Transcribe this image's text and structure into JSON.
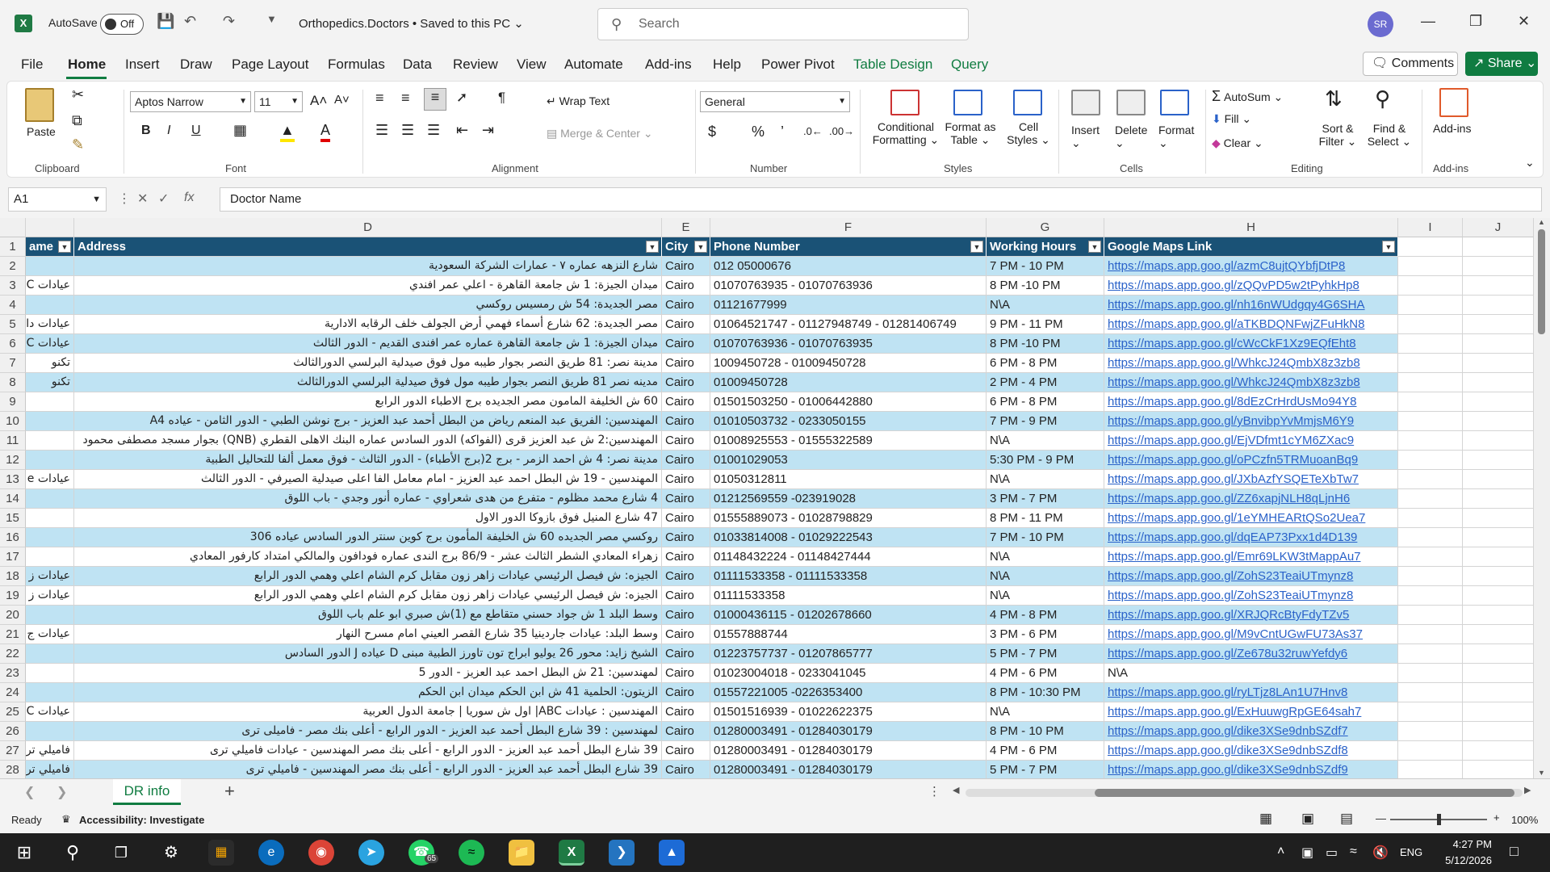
{
  "titlebar": {
    "autosave_label": "AutoSave",
    "autosave_state": "Off",
    "document_title": "Orthopedics.Doctors • Saved to this PC",
    "search_placeholder": "Search",
    "user_initials": "SR"
  },
  "menu": [
    "File",
    "Home",
    "Insert",
    "Draw",
    "Page Layout",
    "Formulas",
    "Data",
    "Review",
    "View",
    "Automate",
    "Add-ins",
    "Help",
    "Power Pivot",
    "Table Design",
    "Query"
  ],
  "menu_active": "Home",
  "actions": {
    "comments": "Comments",
    "share": "Share"
  },
  "ribbon": {
    "clipboard": {
      "label": "Clipboard",
      "paste": "Paste"
    },
    "font": {
      "label": "Font",
      "name": "Aptos Narrow",
      "size": "11"
    },
    "alignment": {
      "label": "Alignment",
      "wrap": "Wrap Text",
      "merge": "Merge & Center"
    },
    "number": {
      "label": "Number",
      "format": "General"
    },
    "styles": {
      "label": "Styles",
      "conditional": "Conditional",
      "conditional2": "Formatting",
      "format_as": "Format as",
      "format_as2": "Table",
      "cell": "Cell",
      "cell2": "Styles"
    },
    "cells": {
      "label": "Cells",
      "insert": "Insert",
      "delete": "Delete",
      "format": "Format"
    },
    "editing": {
      "label": "Editing",
      "autosum": "AutoSum",
      "fill": "Fill",
      "clear": "Clear",
      "sort": "Sort &",
      "sort2": "Filter",
      "find": "Find &",
      "find2": "Select"
    },
    "addins": {
      "label": "Add-ins",
      "btn": "Add-ins"
    }
  },
  "formula_bar": {
    "name_box": "A1",
    "formula": "Doctor Name"
  },
  "columns": [
    "D",
    "E",
    "F",
    "G",
    "H",
    "I",
    "J"
  ],
  "table_headers": {
    "c": "ame",
    "d": "Address",
    "e": "City",
    "f": "Phone Number",
    "g": "Working Hours",
    "h": "Google Maps Link"
  },
  "rows": [
    {
      "n": "2",
      "c": "",
      "d": "شارع النزهه عماره ٧ - عمارات الشركة السعودية",
      "e": "Cairo",
      "f": "012 05000676",
      "g": "7 PM - 10 PM",
      "h": "https://maps.app.goo.gl/azmC8ujtQYbfjDtP8"
    },
    {
      "n": "3",
      "c": "عيادات C",
      "d": "ميدان الجيزة: 1 ش جامعة القاهرة - اعلي عمر افندي",
      "e": "Cairo",
      "f": "01070763935 - 01070763936",
      "g": "8 PM -10 PM",
      "h": "https://maps.app.goo.gl/zQQvPD5w2tPyhkHp8"
    },
    {
      "n": "4",
      "c": "",
      "d": "مصر الجديدة: 54 ش رمسيس روكسي",
      "e": "Cairo",
      "f": "01121677999",
      "g": "N\\A",
      "h": "https://maps.app.goo.gl/nh16nWUdgqy4G6SHA"
    },
    {
      "n": "5",
      "c": "عيادات دا",
      "d": "مصر الجديدة: 62 شارع أسماء فهمي أرض الجولف خلف الرقابه الادارية",
      "e": "Cairo",
      "f": "01064521747 - 01127948749 - 01281406749",
      "g": "9 PM - 11 PM",
      "h": "https://maps.app.goo.gl/aTKBDQNFwjZFuHkN8"
    },
    {
      "n": "6",
      "c": "عيادات C",
      "d": "ميدان الجيزة: 1 ش جامعة القاهرة عماره عمر افندى القديم - الدور الثالث",
      "e": "Cairo",
      "f": "01070763936 - 01070763935",
      "g": "8 PM -10 PM",
      "h": "https://maps.app.goo.gl/cWcCkF1Xz9EQfEht8"
    },
    {
      "n": "7",
      "c": "تكنو",
      "d": "مدينة نصر: 81 طريق النصر بجوار طيبه مول فوق صيدلية البرلسي الدورالثالث",
      "e": "Cairo",
      "f": "1009450728 - 01009450728",
      "g": "6 PM - 8 PM",
      "h": "https://maps.app.goo.gl/WhkcJ24QmbX8z3zb8"
    },
    {
      "n": "8",
      "c": "تكنو",
      "d": "مدينه نصر 81 طريق النصر بجوار طيبه مول فوق صيدلية البرلسي الدورالثالث",
      "e": "Cairo",
      "f": "01009450728",
      "g": "2 PM - 4 PM",
      "h": "https://maps.app.goo.gl/WhkcJ24QmbX8z3zb8"
    },
    {
      "n": "9",
      "c": "",
      "d": "60 ش الخليفة المامون مصر الجديده برج الاطباء الدور الرابع",
      "e": "Cairo",
      "f": "01501503250 - 01006442880",
      "g": "6 PM - 8 PM",
      "h": "https://maps.app.goo.gl/8dEzCrHrdUsMo94Y8"
    },
    {
      "n": "10",
      "c": "",
      "d": "المهندسين: الفريق عبد المنعم رياض من البطل أحمد عبد العزيز - برج نوشن الطبي - الدور الثامن - عياده A4",
      "e": "Cairo",
      "f": "01010503732 - 0233050155",
      "g": "7 PM - 9 PM",
      "h": "https://maps.app.goo.gl/yBnvibpYvMmjsM6Y9"
    },
    {
      "n": "11",
      "c": "",
      "d": "المهندسين:2 ش عبد العزيز قرى (الفواكه) الدور السادس عماره البنك الاهلى القطري (QNB) بجوار مسجد مصطفى محمود",
      "e": "Cairo",
      "f": "01008925553 - 01555322589",
      "g": "N\\A",
      "h": "https://maps.app.goo.gl/EjVDfmt1cYM6ZXac9"
    },
    {
      "n": "12",
      "c": "",
      "d": "مدينة نصر: 4 ش احمد الزمر - برج 2(برج الأطباء) - الدور الثالث - فوق معمل ألفا للتحاليل الطبية",
      "e": "Cairo",
      "f": "01001029053",
      "g": "5:30 PM - 9 PM",
      "h": "https://maps.app.goo.gl/oPCzfn5TRMuoanBq9"
    },
    {
      "n": "13",
      "c": "عيادات e",
      "d": "المهندسين - 19 ش البطل احمد عبد العزيز - امام معامل الفا اعلى صيدلية الصيرفي - الدور الثالث",
      "e": "Cairo",
      "f": "01050312811",
      "g": "N\\A",
      "h": "https://maps.app.goo.gl/JXbAzfYSQETeXbTw7"
    },
    {
      "n": "14",
      "c": "",
      "d": "4 شارع محمد مظلوم - متفرع من هدى شعراوي - عماره أنور وجدي - باب اللوق",
      "e": "Cairo",
      "f": "01212569559 -023919028",
      "g": "3 PM - 7 PM",
      "h": "https://maps.app.goo.gl/ZZ6xapjNLH8qLjnH6"
    },
    {
      "n": "15",
      "c": "",
      "d": "47 شارع المنيل فوق بازوكا الدور الاول",
      "e": "Cairo",
      "f": "01555889073 - 01028798829",
      "g": "8 PM - 11 PM",
      "h": "https://maps.app.goo.gl/1eYMHEARtQSo2Uea7"
    },
    {
      "n": "16",
      "c": "",
      "d": "روكسي مصر الجديده 60 ش الخليفة المأمون برج كوين سنتر الدور السادس عياده 306",
      "e": "Cairo",
      "f": "01033814008 - 01029222543",
      "g": "7 PM - 10 PM",
      "h": "https://maps.app.goo.gl/dqEAP73Pxx1d4D139"
    },
    {
      "n": "17",
      "c": "",
      "d": "زهراء المعادي الشطر الثالث عشر - 86/9 برج الندى عماره فودافون والمالكي امتداد كارفور المعادي",
      "e": "Cairo",
      "f": "01148432224 - 01148427444",
      "g": "N\\A",
      "h": "https://maps.app.goo.gl/Emr69LKW3tMappAu7"
    },
    {
      "n": "18",
      "c": "عيادات ز",
      "d": "الجيزه: ش فيصل الرئيسي عيادات زاهر زون مقابل كرم الشام اعلي وهمي الدور الرابع",
      "e": "Cairo",
      "f": "01111533358 - 01111533358",
      "g": "N\\A",
      "h": "https://maps.app.goo.gl/ZohS23TeaiUTmynz8"
    },
    {
      "n": "19",
      "c": "عيادات ز",
      "d": "الجيزه: ش فيصل الرئيسي عيادات زاهر زون مقابل كرم الشام اعلي وهمي الدور الرابع",
      "e": "Cairo",
      "f": "01111533358",
      "g": "N\\A",
      "h": "https://maps.app.goo.gl/ZohS23TeaiUTmynz8"
    },
    {
      "n": "20",
      "c": "",
      "d": "وسط البلد 1 ش جواد حسني متقاطع مع (1)ش صبري ابو علم باب اللوق",
      "e": "Cairo",
      "f": "01000436115 - 01202678660",
      "g": "4 PM - 8 PM",
      "h": "https://maps.app.goo.gl/XRJQRcBtyFdyTZv5"
    },
    {
      "n": "21",
      "c": "عيادات ج",
      "d": "وسط البلد: عيادات جاردينيا 35 شارع القصر العيني امام مسرح النهار",
      "e": "Cairo",
      "f": "01557888744",
      "g": "3 PM - 6 PM",
      "h": "https://maps.app.goo.gl/M9vCntUGwFU73As37"
    },
    {
      "n": "22",
      "c": "",
      "d": "الشيخ زايد: محور 26 يوليو ابراج تون تاورز الطبية مبنى D عياده J الدور السادس",
      "e": "Cairo",
      "f": "01223757737 - 01207865777",
      "g": "5 PM - 7 PM",
      "h": "https://maps.app.goo.gl/Ze678u32ruwYefdy6"
    },
    {
      "n": "23",
      "c": "",
      "d": "لمهندسين: 21 ش البطل احمد عبد العزيز - الدور 5",
      "e": "Cairo",
      "f": "01023004018 - 0233041045",
      "g": "4 PM - 6 PM",
      "h": "N\\A"
    },
    {
      "n": "24",
      "c": "",
      "d": "الزيتون: الحلمية 41 ش ابن الحكم ميدان ابن الحكم",
      "e": "Cairo",
      "f": "01557221005 -0226353400",
      "g": "8 PM - 10:30 PM",
      "h": "https://maps.app.goo.gl/ryLTjz8LAn1U7Hnv8"
    },
    {
      "n": "25",
      "c": "عيادات C",
      "d": "المهندسين : عيادات ABC| اول ش سوريا | جامعة الدول العربية",
      "e": "Cairo",
      "f": "01501516939 - 01022622375",
      "g": "N\\A",
      "h": "https://maps.app.goo.gl/ExHuuwgRpGE64sah7"
    },
    {
      "n": "26",
      "c": "",
      "d": "لمهندسين : 39 شارع البطل أحمد عبد العزيز - الدور الرابع - أعلى بنك مصر - فاميلى ترى",
      "e": "Cairo",
      "f": "01280003491 - 01284030179",
      "g": "8 PM - 10 PM",
      "h": "https://maps.app.goo.gl/dike3XSe9dnbSZdf7"
    },
    {
      "n": "27",
      "c": "فاميلي تر",
      "d": "39 شارع البطل أحمد عبد العزيز - الدور الرابع - أعلى بنك مصر المهندسين - عيادات فاميلي ترى",
      "e": "Cairo",
      "f": "01280003491 - 01284030179",
      "g": "4 PM - 6 PM",
      "h": "https://maps.app.goo.gl/dike3XSe9dnbSZdf8"
    },
    {
      "n": "28",
      "c": "فاميلي تر",
      "d": "39 شارع البطل أحمد عبد العزيز - الدور الرابع - أعلى بنك مصر المهندسين - فاميلي ترى",
      "e": "Cairo",
      "f": "01280003491 - 01284030179",
      "g": "5 PM - 7 PM",
      "h": "https://maps.app.goo.gl/dike3XSe9dnbSZdf9"
    }
  ],
  "sheet": {
    "tab": "DR info",
    "add": "+"
  },
  "status": {
    "ready": "Ready",
    "accessibility": "Accessibility: Investigate",
    "zoom": "100%"
  },
  "taskbar": {
    "time": "4:27 PM",
    "date": "5/12/2026",
    "lang": "ENG",
    "badge": "65"
  }
}
